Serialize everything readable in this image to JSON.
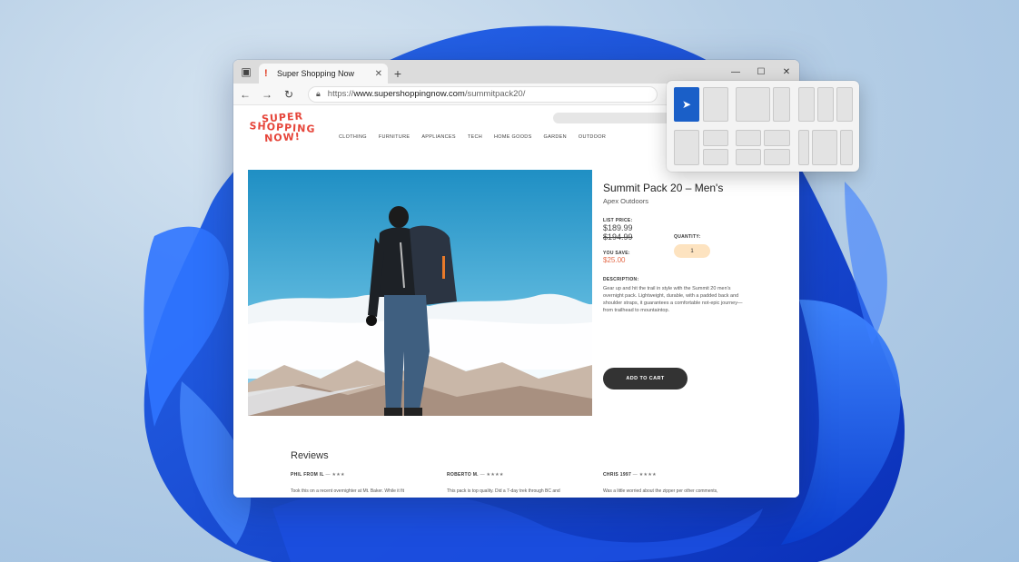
{
  "browser": {
    "tab_title": "Super Shopping Now",
    "tab_favicon": "!",
    "tab_close": "✕",
    "new_tab": "+",
    "window_controls": {
      "minimize": "—",
      "maximize": "☐",
      "close": "✕"
    },
    "nav": {
      "back": "←",
      "forward": "→",
      "refresh": "↻"
    },
    "url_prefix": "https://",
    "url_domain": "www.supershoppingnow.com",
    "url_path": "/summitpack20/"
  },
  "site": {
    "logo_lines": [
      "SUPER",
      "SHOPPING",
      "NOW!"
    ],
    "menu": [
      "CLOTHING",
      "FURNITURE",
      "APPLIANCES",
      "TECH",
      "HOME GOODS",
      "GARDEN",
      "OUTDOOR"
    ]
  },
  "product": {
    "name": "Summit Pack 20 – Men's",
    "brand": "Apex Outdoors",
    "list_price_label": "LIST PRICE:",
    "price": "$189.99",
    "old_price": "$194.99",
    "quantity_label": "QUANTITY:",
    "quantity": "1",
    "you_save_label": "YOU SAVE:",
    "you_save": "$25.00",
    "description_label": "DESCRIPTION:",
    "description": "Gear up and hit the trail in style with the Summit 20 men's overnight pack. Lightweight, durable, with a padded back and shoulder straps, it guarantees a comfortable not-epic journey—from trailhead to mountaintop.",
    "add_to_cart": "ADD TO CART"
  },
  "reviews": {
    "title": "Reviews",
    "items": [
      {
        "author": "PHIL FROM IL",
        "stars": "— ★★★",
        "text": "Took this on a recent overnighter at Mt. Baker. While it fit"
      },
      {
        "author": "ROBERTO M.",
        "stars": "— ★★★★",
        "text": "This pack is top quality. Did a 7-day trek through BC and"
      },
      {
        "author": "CHRIS 1997",
        "stars": "— ★★★★",
        "text": "Was a little worried about the zipper per other comments,"
      }
    ]
  },
  "colors": {
    "accent_blue": "#1a5fc8",
    "logo_red": "#e6453a",
    "save_orange": "#e36b4a"
  }
}
